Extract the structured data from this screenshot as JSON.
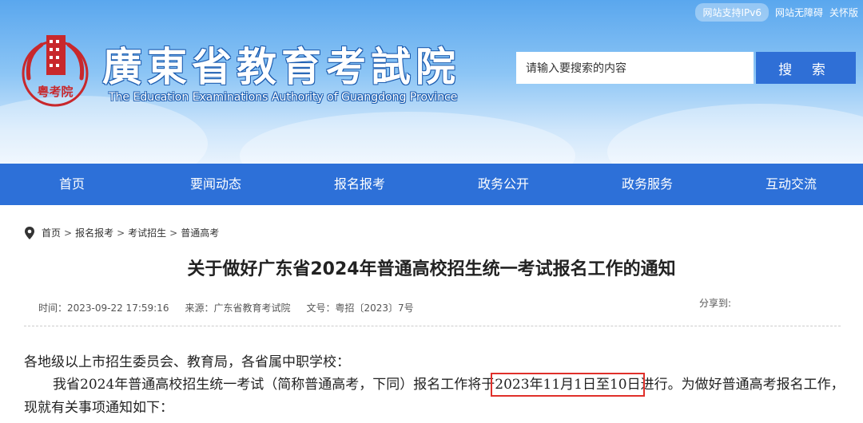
{
  "top_links": {
    "ipv6": "网站支持IPv6",
    "accessibility": "网站无障碍",
    "care_mode": "关怀版"
  },
  "site": {
    "title_cn": "廣東省教育考試院",
    "title_en": "The Education Examinations Authority of Guangdong Province",
    "logo_text": "粤考院"
  },
  "search": {
    "placeholder": "请输入要搜索的内容",
    "button": "搜 索"
  },
  "nav": [
    {
      "label": "首页"
    },
    {
      "label": "要闻动态"
    },
    {
      "label": "报名报考"
    },
    {
      "label": "政务公开"
    },
    {
      "label": "政务服务"
    },
    {
      "label": "互动交流"
    }
  ],
  "breadcrumb": [
    "首页",
    "报名报考",
    "考试招生",
    "普通高考"
  ],
  "breadcrumb_sep": ">",
  "article": {
    "title": "关于做好广东省2024年普通高校招生统一考试报名工作的通知",
    "time": "时间：2023-09-22 17:59:16",
    "source": "来源：广东省教育考试院",
    "doc_no": "文号：粤招〔2023〕7号",
    "share_label": "分享到:",
    "greeting": "各地级以上市招生委员会、教育局，各省属中职学校：",
    "para_before": "我省2024年普通高校招生统一考试（简称普通高考，下同）报名工作将于",
    "para_highlight": "2023年11月1日至10日",
    "para_after": "进行。为做好普通高考报名工作，现就有关事项通知如下："
  },
  "colors": {
    "nav_bg": "#2d70d8",
    "search_button": "#2f6fd6",
    "highlight_box": "#e0302a",
    "logo_red": "#c8282c"
  }
}
